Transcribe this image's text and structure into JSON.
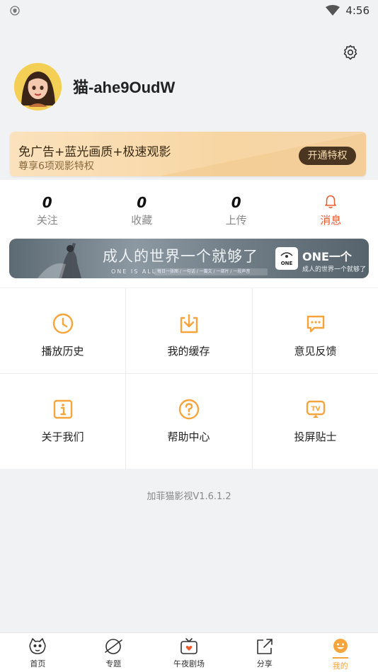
{
  "status_bar": {
    "time": "4:56"
  },
  "profile": {
    "username": "猫-ahe9OudW"
  },
  "vip": {
    "title": "免广告+蓝光画质+极速观影",
    "subtitle": "尊享6项观影特权",
    "button": "开通特权"
  },
  "stats": [
    {
      "value": "0",
      "label": "关注"
    },
    {
      "value": "0",
      "label": "收藏"
    },
    {
      "value": "0",
      "label": "上传"
    },
    {
      "label": "消息"
    }
  ],
  "banner": {
    "headline": "成人的世界一个就够了",
    "sub": "ONE IS ALL",
    "strip": "每日一张图 / 一句话 / 一篇文 / 一部片 / 一段声音",
    "brand": "ONE一个",
    "logo_text": "ONE",
    "tagline": "成人的世界一个就够了"
  },
  "menu": [
    {
      "label": "播放历史",
      "icon": "clock-icon"
    },
    {
      "label": "我的缓存",
      "icon": "download-icon"
    },
    {
      "label": "意见反馈",
      "icon": "chat-icon"
    },
    {
      "label": "关于我们",
      "icon": "info-icon"
    },
    {
      "label": "帮助中心",
      "icon": "help-icon"
    },
    {
      "label": "投屏贴士",
      "icon": "tv-icon"
    }
  ],
  "version": "加菲猫影视V1.6.1.2",
  "tabs": [
    {
      "label": "首页",
      "icon": "cat-icon"
    },
    {
      "label": "专题",
      "icon": "planet-icon"
    },
    {
      "label": "午夜剧场",
      "icon": "tv-heart-icon"
    },
    {
      "label": "分享",
      "icon": "share-icon"
    },
    {
      "label": "我的",
      "icon": "smile-icon",
      "active": true
    }
  ],
  "colors": {
    "accent": "#f7a43a",
    "message": "#f05a2b",
    "vip_button": "#4a3620"
  }
}
